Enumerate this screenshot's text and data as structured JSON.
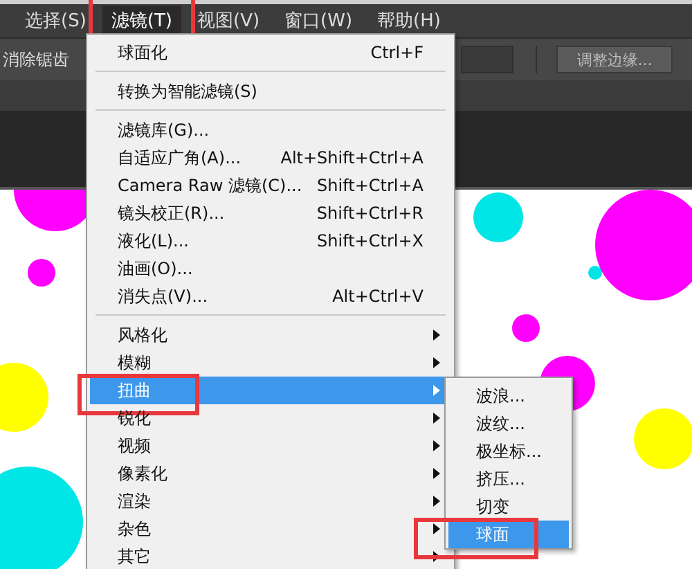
{
  "menu_bar": [
    {
      "label": "选择(S)",
      "selected": false,
      "annotated": false
    },
    {
      "label": "滤镜(T)",
      "selected": true,
      "annotated": true
    },
    {
      "label": "视图(V)",
      "selected": false,
      "annotated": false
    },
    {
      "label": "窗口(W)",
      "selected": false,
      "annotated": false
    },
    {
      "label": "帮助(H)",
      "selected": false,
      "annotated": false
    }
  ],
  "options_bar": {
    "label": "消除锯齿",
    "button": "调整边缘..."
  },
  "filter_menu": {
    "items": [
      {
        "kind": "item",
        "label": "球面化",
        "shortcut": "Ctrl+F"
      },
      {
        "kind": "separator"
      },
      {
        "kind": "item",
        "label": "转换为智能滤镜(S)"
      },
      {
        "kind": "separator"
      },
      {
        "kind": "item",
        "label": "滤镜库(G)..."
      },
      {
        "kind": "item",
        "label": "自适应广角(A)...",
        "shortcut": "Alt+Shift+Ctrl+A"
      },
      {
        "kind": "item",
        "label": "Camera Raw 滤镜(C)...",
        "shortcut": "Shift+Ctrl+A"
      },
      {
        "kind": "item",
        "label": "镜头校正(R)...",
        "shortcut": "Shift+Ctrl+R"
      },
      {
        "kind": "item",
        "label": "液化(L)...",
        "shortcut": "Shift+Ctrl+X"
      },
      {
        "kind": "item",
        "label": "油画(O)..."
      },
      {
        "kind": "item",
        "label": "消失点(V)...",
        "shortcut": "Alt+Ctrl+V"
      },
      {
        "kind": "separator"
      },
      {
        "kind": "submenu",
        "label": "风格化",
        "selected": false,
        "annotated": false
      },
      {
        "kind": "submenu",
        "label": "模糊",
        "selected": false,
        "annotated": false
      },
      {
        "kind": "submenu",
        "label": "扭曲",
        "selected": true,
        "annotated": true
      },
      {
        "kind": "submenu",
        "label": "锐化",
        "selected": false,
        "annotated": false
      },
      {
        "kind": "submenu",
        "label": "视频",
        "selected": false,
        "annotated": false
      },
      {
        "kind": "submenu",
        "label": "像素化",
        "selected": false,
        "annotated": false
      },
      {
        "kind": "submenu",
        "label": "渲染",
        "selected": false,
        "annotated": false
      },
      {
        "kind": "submenu",
        "label": "杂色",
        "selected": false,
        "annotated": false
      },
      {
        "kind": "submenu",
        "label": "其它",
        "selected": false,
        "annotated": false
      }
    ]
  },
  "distort_submenu": {
    "items": [
      {
        "label": "波浪...",
        "selected": false,
        "annotated": false
      },
      {
        "label": "波纹...",
        "selected": false,
        "annotated": false
      },
      {
        "label": "极坐标...",
        "selected": false,
        "annotated": false
      },
      {
        "label": "挤压...",
        "selected": false,
        "annotated": false
      },
      {
        "label": "切变",
        "selected": false,
        "annotated": false
      },
      {
        "label": "球面",
        "selected": true,
        "annotated": true
      }
    ]
  }
}
